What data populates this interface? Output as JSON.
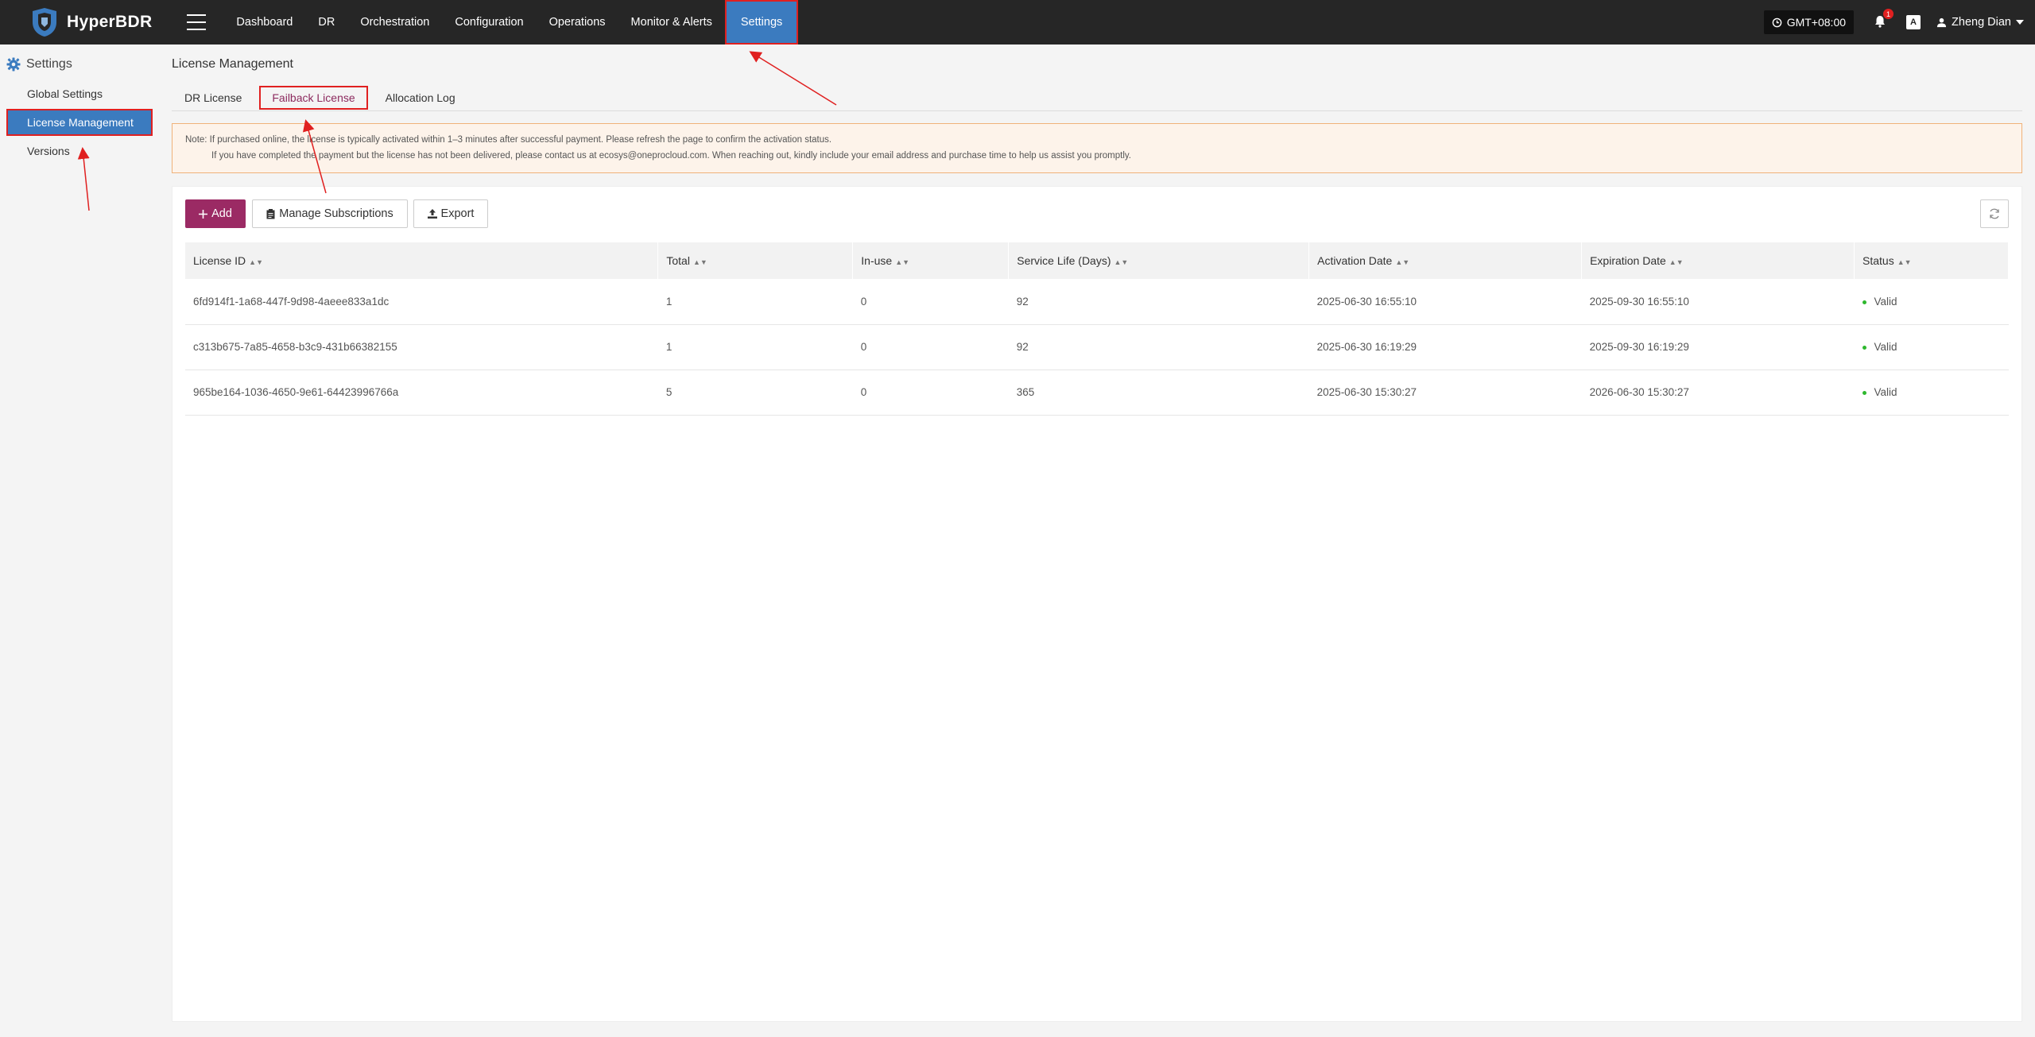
{
  "app": {
    "name": "HyperBDR"
  },
  "nav": {
    "items": [
      {
        "label": "Dashboard",
        "active": false
      },
      {
        "label": "DR",
        "active": false
      },
      {
        "label": "Orchestration",
        "active": false
      },
      {
        "label": "Configuration",
        "active": false
      },
      {
        "label": "Operations",
        "active": false
      },
      {
        "label": "Monitor & Alerts",
        "active": false
      },
      {
        "label": "Settings",
        "active": true
      }
    ]
  },
  "header_right": {
    "timezone": "GMT+08:00",
    "notification_count": "1",
    "lang_icon_text": "A",
    "user_name": "Zheng Dian"
  },
  "sidebar": {
    "title": "Settings",
    "items": [
      {
        "label": "Global Settings",
        "active": false
      },
      {
        "label": "License Management",
        "active": true
      },
      {
        "label": "Versions",
        "active": false
      }
    ]
  },
  "main": {
    "title": "License Management",
    "tabs": [
      {
        "label": "DR License",
        "active": false
      },
      {
        "label": "Failback License",
        "active": true
      },
      {
        "label": "Allocation Log",
        "active": false
      }
    ],
    "notice": {
      "line1": "Note: If purchased online, the license is typically activated within 1–3 minutes after successful payment. Please refresh the page to confirm the activation status.",
      "line2": "If you have completed the payment but the license has not been delivered, please contact us at ecosys@oneprocloud.com. When reaching out, kindly include your email address and purchase time to help us assist you promptly."
    },
    "toolbar": {
      "add_label": "Add",
      "manage_label": "Manage Subscriptions",
      "export_label": "Export"
    },
    "table": {
      "columns": [
        "License ID",
        "Total",
        "In-use",
        "Service Life (Days)",
        "Activation Date",
        "Expiration Date",
        "Status"
      ],
      "rows": [
        [
          "6fd914f1-1a68-447f-9d98-4aeee833a1dc",
          "1",
          "0",
          "92",
          "2025-06-30 16:55:10",
          "2025-09-30 16:55:10",
          "Valid"
        ],
        [
          "c313b675-7a85-4658-b3c9-431b66382155",
          "1",
          "0",
          "92",
          "2025-06-30 16:19:29",
          "2025-09-30 16:19:29",
          "Valid"
        ],
        [
          "965be164-1036-4650-9e61-64423996766a",
          "5",
          "0",
          "365",
          "2025-06-30 15:30:27",
          "2026-06-30 15:30:27",
          "Valid"
        ]
      ]
    }
  },
  "colors": {
    "topbar": "#262626",
    "active_blue": "#3b7bbf",
    "primary_button": "#9b2a64",
    "highlight_red": "#e02020",
    "status_green": "#2eb82e"
  }
}
